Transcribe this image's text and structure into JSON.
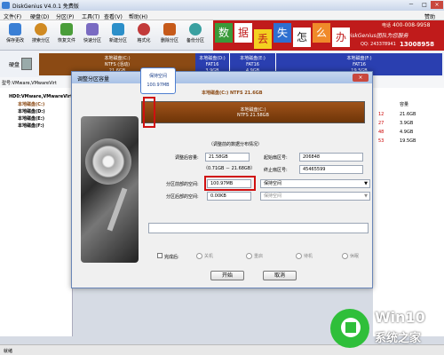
{
  "window": {
    "title": "DiskGenius V4.0.1 免费版",
    "controls": [
      "－",
      "□",
      "×"
    ]
  },
  "menu": [
    "文件(F)",
    "硬盘(D)",
    "分区(P)",
    "工具(T)",
    "查看(V)",
    "帮助(H)"
  ],
  "menu_right": "赞助",
  "toolbar": [
    {
      "label": "保存更改",
      "icon": "save-icon",
      "color": "#3a7fd5"
    },
    {
      "label": "搜索分区",
      "icon": "search-icon",
      "color": "#d08a22"
    },
    {
      "label": "恢复文件",
      "icon": "recover-icon",
      "color": "#4a9d3a"
    },
    {
      "label": "快速分区",
      "icon": "quick-partition-icon",
      "color": "#7a6bc2"
    },
    {
      "label": "新建分区",
      "icon": "new-partition-icon",
      "color": "#2c8fc9"
    },
    {
      "label": "格式化",
      "icon": "format-icon",
      "color": "#c23a3a"
    },
    {
      "label": "删除分区",
      "icon": "delete-icon",
      "color": "#c65a1a"
    },
    {
      "label": "备份分区",
      "icon": "backup-icon",
      "color": "#3aa0a0"
    }
  ],
  "banner": {
    "chars": [
      "数",
      "据",
      "丢",
      "失",
      "怎",
      "么",
      "办"
    ],
    "brand": "DiskGenius团队为您服务",
    "phone_label": "电话",
    "phone1": "400-008-9958",
    "qq": "QQ: 243378941",
    "phone2": "13008958"
  },
  "disk": {
    "partitions": [
      {
        "name": "本地磁盘(C:)",
        "fs": "NTFS (活动)",
        "size": "21.6GB",
        "color": "#8b4a14"
      },
      {
        "name": "本地磁盘(D:)",
        "fs": "FAT16",
        "size": "3.9GB",
        "color": "#2a3fb0"
      },
      {
        "name": "本地磁盘(E:)",
        "fs": "FAT16",
        "size": "4.9GB",
        "color": "#2a3fb0"
      },
      {
        "name": "本地磁盘(F:)",
        "fs": "FAT16",
        "size": "19.5GB",
        "color": "#2a3fb0"
      }
    ],
    "label": "硬盘 0",
    "info": "型号:VMware,VMwareVirt"
  },
  "tree": [
    "HD0:VMware,VMwareVirt",
    "本地磁盘(C:)",
    "本地磁盘(D:)",
    "本地磁盘(E:)",
    "本地磁盘(F:)"
  ],
  "right_table": {
    "header": [
      "",
      "容量"
    ],
    "rows": [
      [
        "12",
        "21.6GB"
      ],
      [
        "27",
        "3.9GB"
      ],
      [
        "48",
        "4.9GB"
      ],
      [
        "53",
        "19.5GB"
      ]
    ]
  },
  "dialog": {
    "title": "调整分区容量",
    "close": "×",
    "tooltip": {
      "title": "保持空间",
      "value": "100.97MB"
    },
    "partition_header": "本地磁盘(C:) NTFS 21.6GB",
    "bar": {
      "name": "本地磁盘(C:)",
      "sub": "NTFS 21.58GB"
    },
    "hint": "（调整前的数据分布情况）",
    "size_after_label": "调整后容量:",
    "size_after_value": "21.58GB",
    "size_range": "（0.71GB － 21.68GB）",
    "start_sector_label": "起始扇区号:",
    "start_sector_value": "206848",
    "end_sector_label": "终止扇区号:",
    "end_sector_value": "45465599",
    "before_space_label": "分区前部的空间:",
    "before_space_value": "100.97MB",
    "before_space_option": "保持空间",
    "after_space_label": "分区后部的空间:",
    "after_space_value": "0.00KB",
    "after_space_option": "保持空间",
    "when_done_label": "完成后:",
    "radio_options": [
      "关机",
      "重启",
      "待机",
      "休眠"
    ],
    "start_button": "开始",
    "cancel_button": "取消"
  },
  "status": "就绪",
  "watermark": {
    "brand": "Win10",
    "subtitle": "系统之家"
  }
}
